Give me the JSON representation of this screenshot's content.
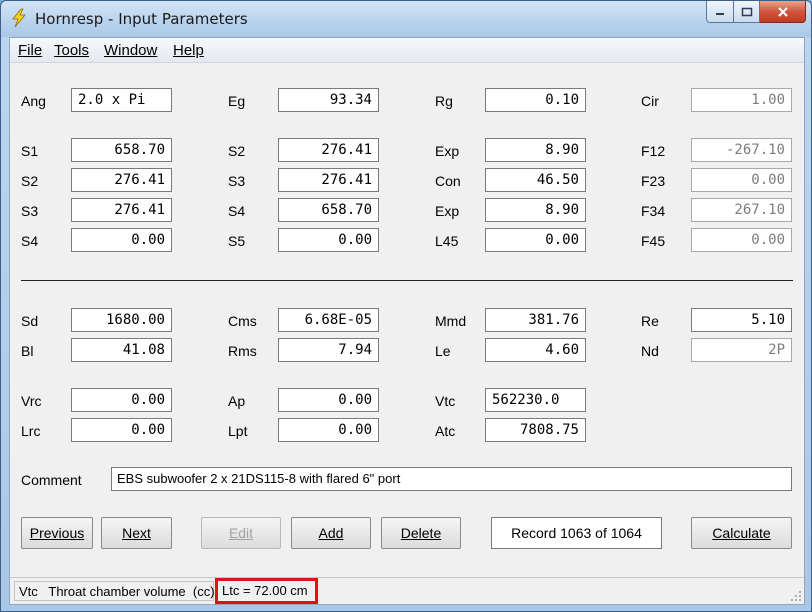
{
  "window": {
    "title": "Hornresp - Input Parameters",
    "icon": "lightning-bolt-icon"
  },
  "menu": [
    "File",
    "Tools",
    "Window",
    "Help"
  ],
  "params": {
    "Ang": "2.0 x Pi",
    "Eg": "93.34",
    "Rg": "0.10",
    "Cir": "1.00",
    "S1": "658.70",
    "S2a": "276.41",
    "Exp1": "8.90",
    "F12": "-267.10",
    "S2b": "276.41",
    "S3a": "276.41",
    "Con": "46.50",
    "F23": "0.00",
    "S3b": "276.41",
    "S4a": "658.70",
    "Exp3": "8.90",
    "F34": "267.10",
    "S4b": "0.00",
    "S5": "0.00",
    "L45": "0.00",
    "F45": "0.00",
    "Sd": "1680.00",
    "Cms": "6.68E-05",
    "Mmd": "381.76",
    "Re": "5.10",
    "Bl": "41.08",
    "Rms": "7.94",
    "Le": "4.60",
    "Nd": "2P",
    "Vrc": "0.00",
    "Ap": "0.00",
    "Vtc": "562230.0",
    "Lrc": "0.00",
    "Lpt": "0.00",
    "Atc": "7808.75"
  },
  "labels": {
    "Ang": "Ang",
    "Eg": "Eg",
    "Rg": "Rg",
    "Cir": "Cir",
    "S1": "S1",
    "S2a": "S2",
    "Exp1": "Exp",
    "F12": "F12",
    "S2b": "S2",
    "S3a": "S3",
    "Con": "Con",
    "F23": "F23",
    "S3b": "S3",
    "S4a": "S4",
    "Exp3": "Exp",
    "F34": "F34",
    "S4b": "S4",
    "S5": "S5",
    "L45": "L45",
    "F45": "F45",
    "Sd": "Sd",
    "Cms": "Cms",
    "Mmd": "Mmd",
    "Re": "Re",
    "Bl": "Bl",
    "Rms": "Rms",
    "Le": "Le",
    "Nd": "Nd",
    "Vrc": "Vrc",
    "Ap": "Ap",
    "Vtc": "Vtc",
    "Lrc": "Lrc",
    "Lpt": "Lpt",
    "Atc": "Atc"
  },
  "comment": {
    "label": "Comment",
    "value": "EBS subwoofer 2 x 21DS115-8 with flared 6\" port"
  },
  "buttons": {
    "previous": "Previous",
    "next": "Next",
    "edit": "Edit",
    "add": "Add",
    "delete": "Delete",
    "record": "Record 1063 of 1064",
    "calculate": "Calculate"
  },
  "status": {
    "hint": "Vtc   Throat chamber volume  (cc)",
    "ltc": "Ltc = 72.00 cm"
  },
  "colors": {
    "highlight": "#e0101a",
    "dim_text": "#7d7d7d"
  }
}
